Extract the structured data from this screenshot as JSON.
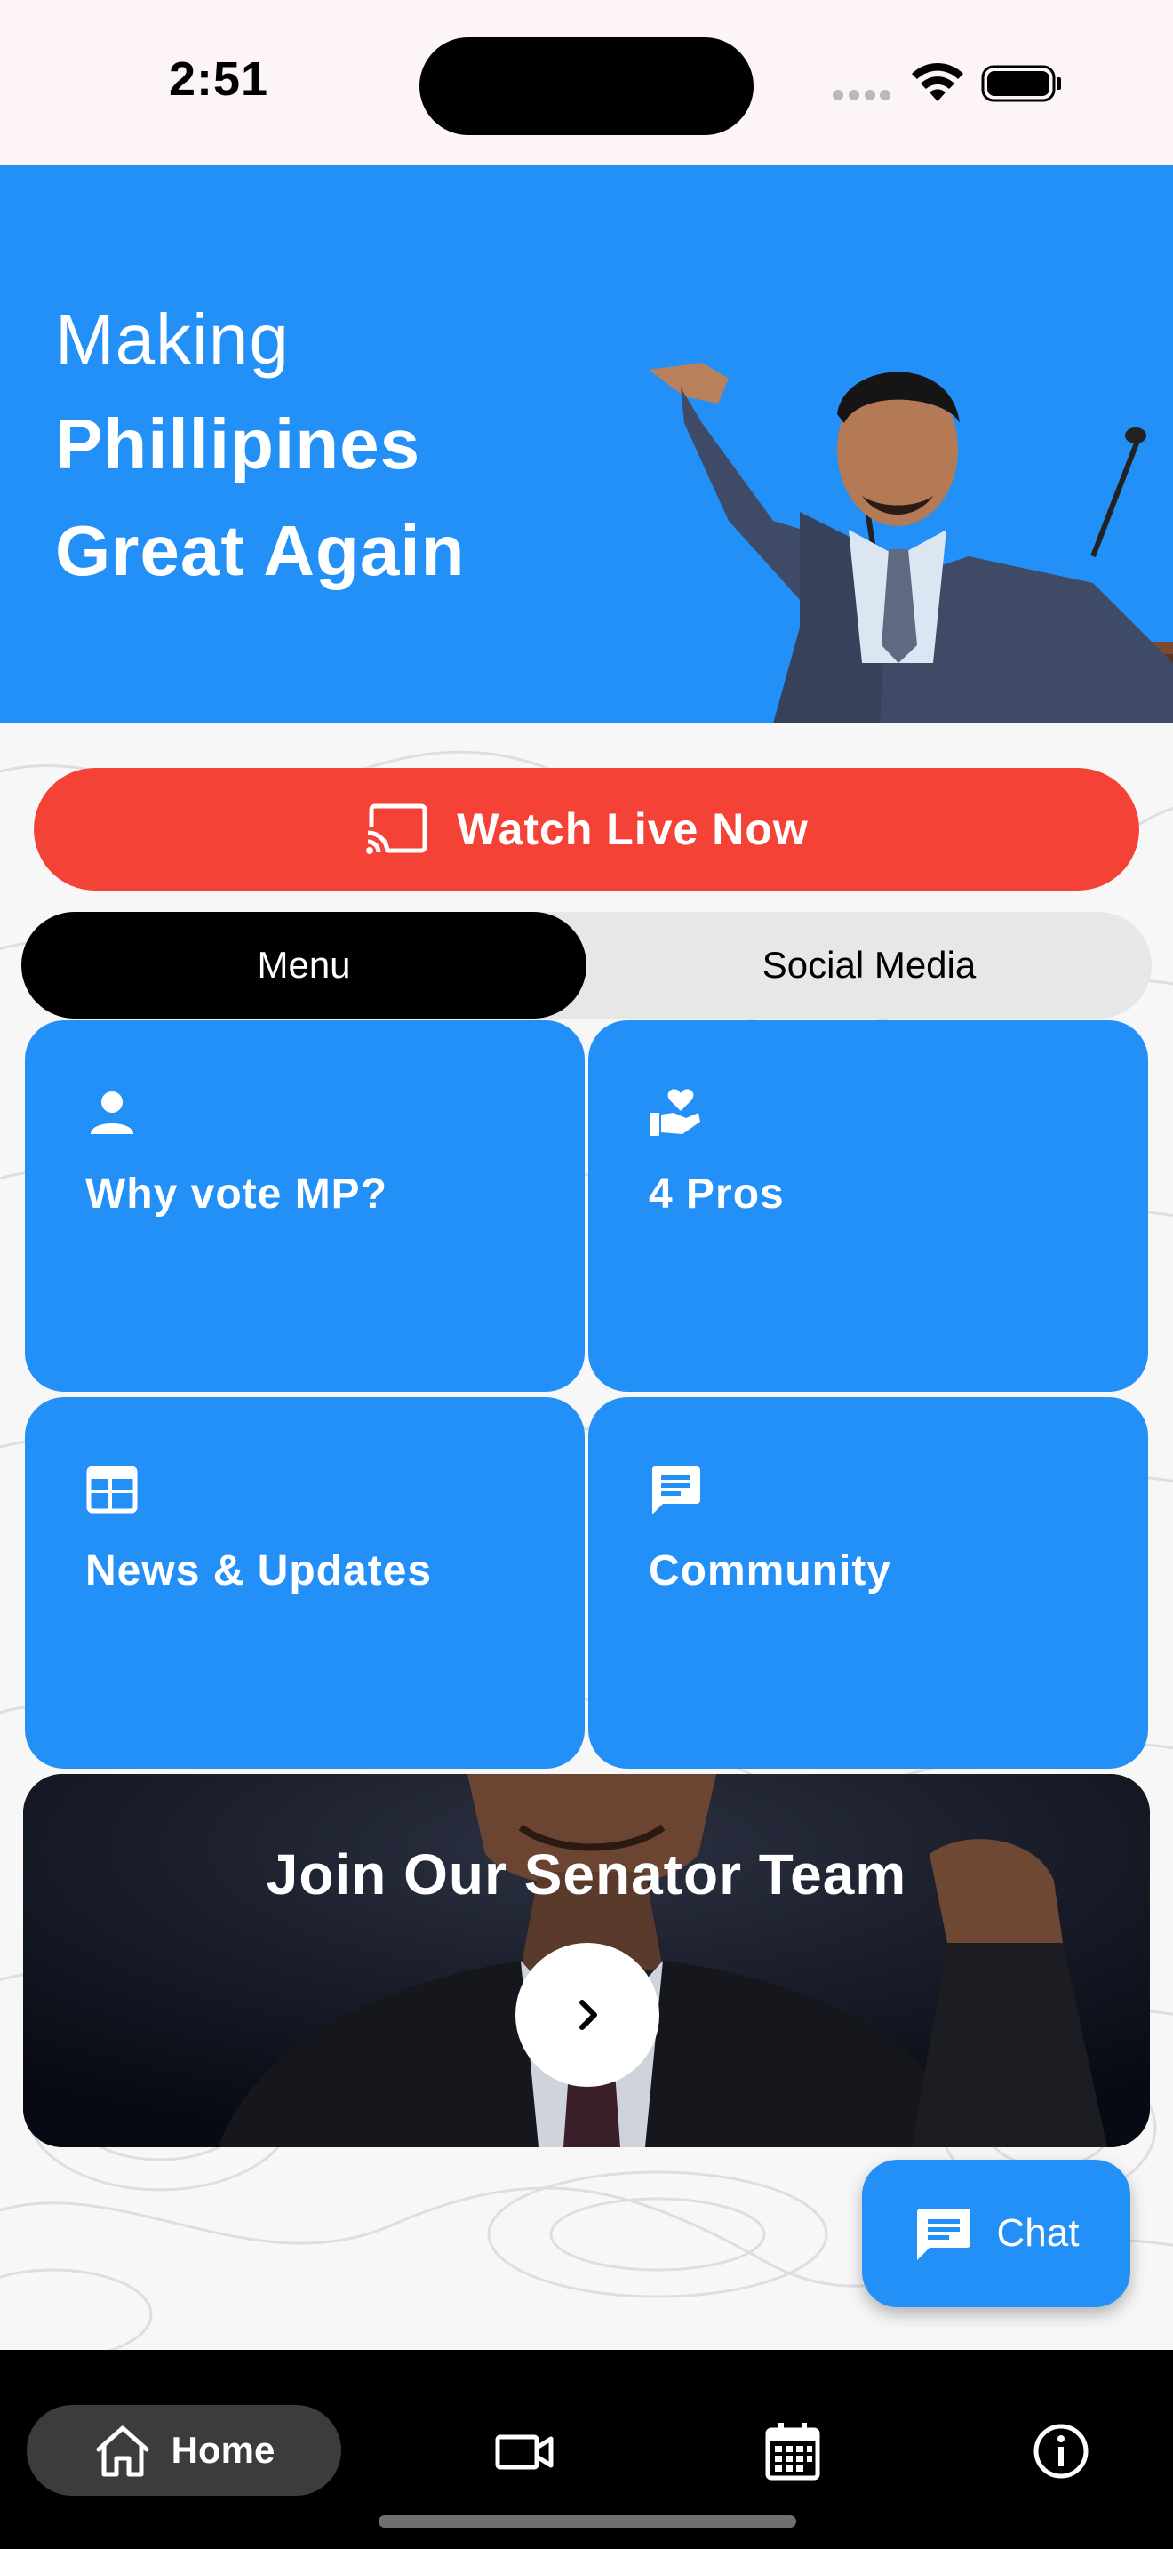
{
  "status_bar": {
    "time": "2:51"
  },
  "hero": {
    "line1": "Making",
    "line2": "Phillipines",
    "line3": "Great Again"
  },
  "watch_button": {
    "label": "Watch Live Now",
    "icon": "cast-icon"
  },
  "segment": {
    "options": [
      "Menu",
      "Social Media"
    ],
    "selected": "Menu"
  },
  "cards": [
    {
      "title": "Why vote MP?",
      "icon": "person-icon"
    },
    {
      "title": "4 Pros",
      "icon": "hand-heart-icon"
    },
    {
      "title": "News & Updates",
      "icon": "newspaper-icon"
    },
    {
      "title": "Community",
      "icon": "message-icon"
    }
  ],
  "join_banner": {
    "title": "Join Our Senator Team",
    "icon": "chevron-right-icon"
  },
  "chat_fab": {
    "label": "Chat",
    "icon": "chat-icon"
  },
  "bottom_nav": {
    "items": [
      {
        "label": "Home",
        "icon": "home-icon",
        "active": true
      },
      {
        "label": "",
        "icon": "video-icon"
      },
      {
        "label": "",
        "icon": "calendar-icon"
      },
      {
        "label": "",
        "icon": "info-icon"
      }
    ]
  },
  "colors": {
    "primary_blue": "#2290f7",
    "live_red": "#f44236",
    "nav_black": "#000000",
    "segment_gray": "#e7e7e7"
  }
}
